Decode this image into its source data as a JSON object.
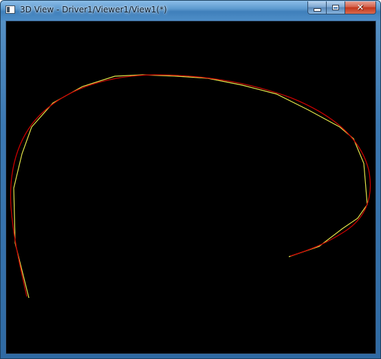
{
  "window": {
    "title": "3D View - Driver1/Viewer1/View1(*)",
    "icon": "window-app-icon",
    "controls": {
      "minimize_icon": "minimize-icon",
      "maximize_icon": "maximize-icon",
      "close_icon": "close-icon",
      "close_glyph": "✕"
    }
  },
  "viewport": {
    "background": "#000000",
    "curves": [
      {
        "name": "fitted-curve",
        "color": "#cc0000"
      },
      {
        "name": "control-polyline",
        "color": "#e8e84a"
      }
    ]
  }
}
